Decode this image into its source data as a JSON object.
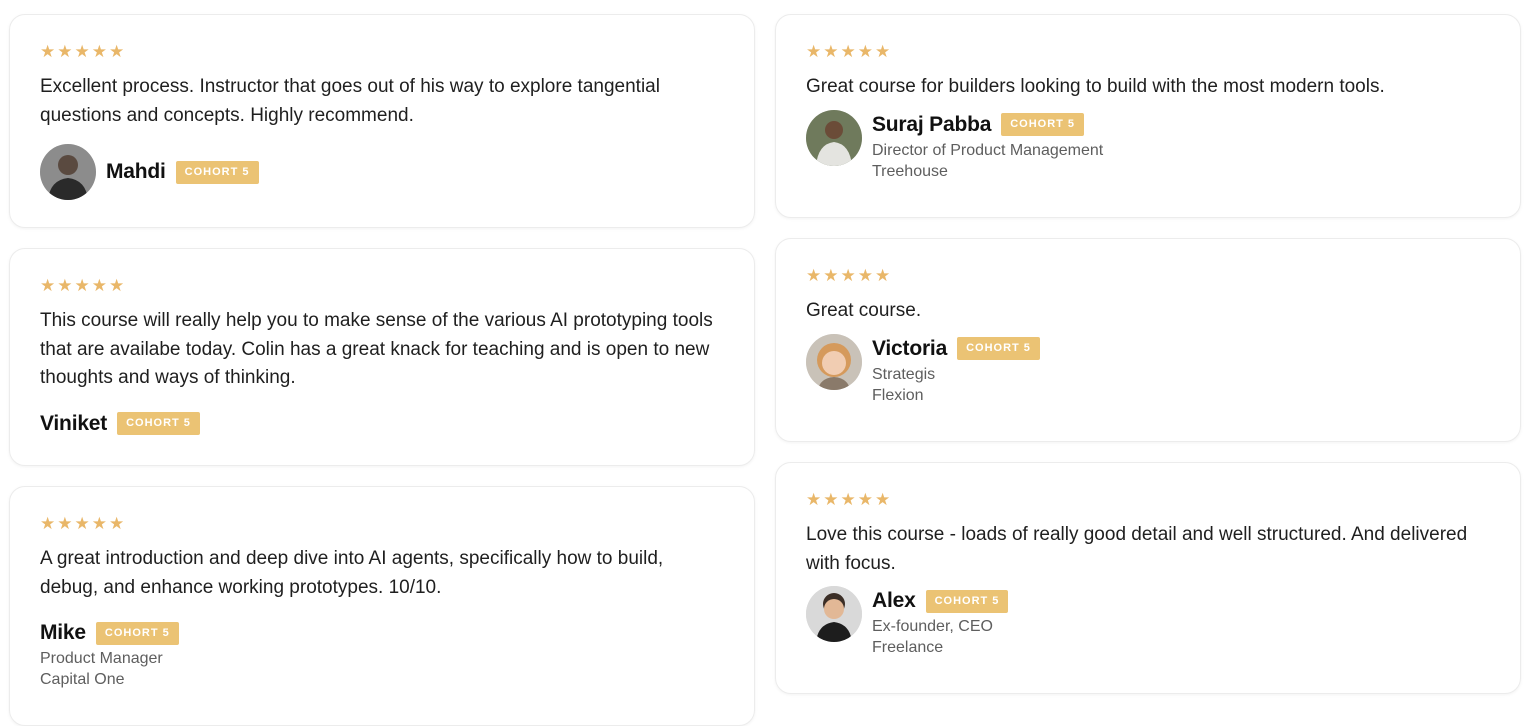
{
  "badge_label": "COHORT 5",
  "star_count": 5,
  "colors": {
    "star": "#e9b769",
    "badge": "#ebc374"
  },
  "left_column": [
    {
      "quote": "Excellent process. Instructor that goes out of his way to explore tangential questions and concepts. Highly recommend.",
      "name": "Mahdi",
      "badge": "COHORT 5",
      "role": "",
      "company": "",
      "avatar": "avatar-photo"
    },
    {
      "quote": "This course will really help you to make sense of the various AI prototyping tools that are availabe today. Colin has a great knack for teaching and is open to new thoughts and ways of thinking.",
      "name": "Viniket",
      "badge": "COHORT 5",
      "role": "",
      "company": ""
    },
    {
      "quote": "A great introduction and deep dive into AI agents, specifically how to build, debug, and enhance working prototypes. 10/10.",
      "name": "Mike",
      "badge": "COHORT 5",
      "role": "Product Manager",
      "company": "Capital One"
    }
  ],
  "right_column": [
    {
      "quote": "Great course for builders looking to build with the most modern tools.",
      "name": "Suraj Pabba",
      "badge": "COHORT 5",
      "role": "Director of Product Management",
      "company": "Treehouse",
      "avatar": "avatar-photo"
    },
    {
      "quote": "Great course.",
      "name": "Victoria",
      "badge": "COHORT 5",
      "role": "Strategis",
      "company": "Flexion",
      "avatar": "avatar-photo"
    },
    {
      "quote": "Love this course - loads of really good detail and well structured. And delivered with focus.",
      "name": "Alex",
      "badge": "COHORT 5",
      "role": "Ex-founder, CEO",
      "company": "Freelance",
      "avatar": "avatar-photo"
    }
  ]
}
